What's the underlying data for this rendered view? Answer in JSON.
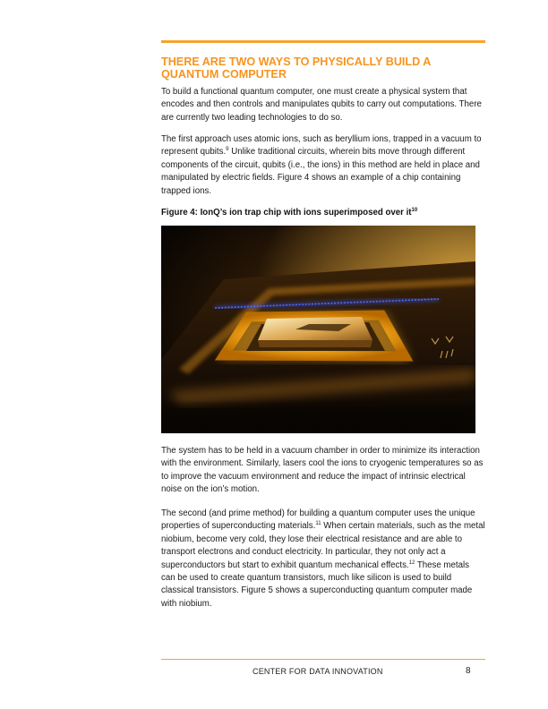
{
  "section": {
    "heading": "THERE ARE TWO WAYS TO PHYSICALLY BUILD A QUANTUM COMPUTER"
  },
  "paragraphs": {
    "p1": "To build a functional quantum computer, one must create a physical system that encodes and then controls and manipulates qubits to carry out computations. There are currently two leading technologies to do so.",
    "p2_before": "The first approach uses atomic ions, such as beryllium ions, trapped in a vacuum to represent qubits.",
    "p2_note": "9",
    "p2_after": " Unlike traditional circuits, wherein bits move through different components of the circuit, qubits (i.e., the ions) in this method are held in place and manipulated by electric fields. Figure 4 shows an example of a chip containing trapped ions.",
    "p3": "The system has to be held in a vacuum chamber in order to minimize its interaction with the environment. Similarly, lasers cool the ions to cryogenic temperatures so as to improve the vacuum environment and reduce the impact of intrinsic electrical noise on the ion’s motion.",
    "p4_a": "The second (and prime method) for building a quantum computer uses the unique properties of superconducting materials.",
    "p4_note1": "11",
    "p4_b": " When certain materials, such as the metal niobium, become very cold, they lose their electrical resistance and are able to transport electrons and conduct electricity. In particular, they not only act a superconductors but start to exhibit quantum mechanical effects.",
    "p4_note2": "12",
    "p4_c": " These metals can be used to create quantum transistors, much like silicon is used to build classical transistors. Figure 5 shows a superconducting quantum computer made with niobium."
  },
  "figure": {
    "caption": "Figure 4: IonQ’s ion trap chip with ions superimposed over it",
    "caption_note": "10"
  },
  "footer": {
    "org": "CENTER FOR DATA INNOVATION",
    "page_number": "8"
  },
  "colors": {
    "accent": "#f7941d",
    "rule": "#f7a32b",
    "ion_glow": "#3b5bff"
  }
}
